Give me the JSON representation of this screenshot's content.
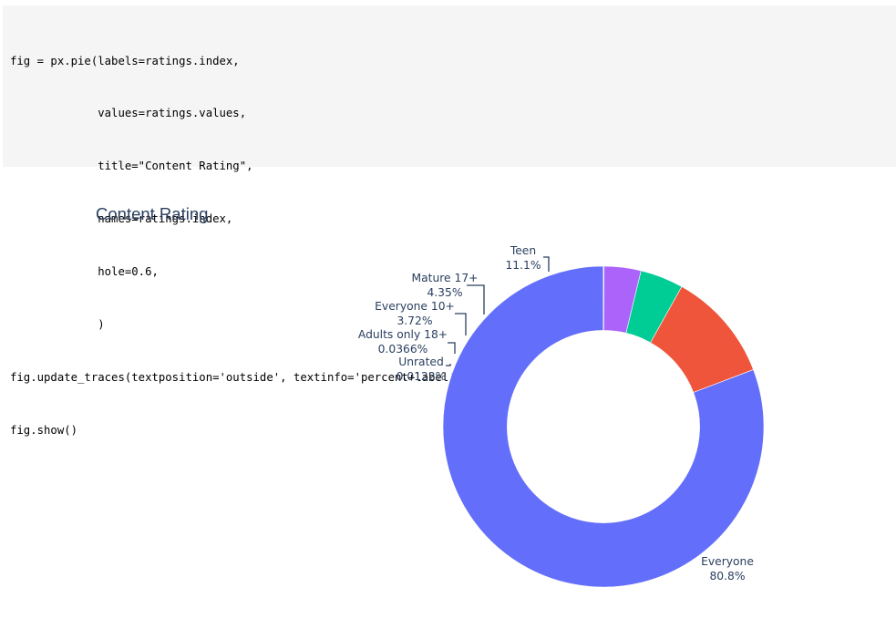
{
  "code_cell": {
    "lines": [
      "fig = px.pie(labels=ratings.index,",
      "             values=ratings.values,",
      "             title=\"Content Rating\",",
      "             names=ratings.index,",
      "             hole=0.6,",
      "             )",
      "fig.update_traces(textposition='outside', textinfo='percent+label')",
      "fig.show()"
    ]
  },
  "chart_data": {
    "type": "pie",
    "title": "Content Rating",
    "hole": 0.6,
    "textposition": "outside",
    "textinfo": "percent+label",
    "slices": [
      {
        "label": "Everyone",
        "percent": 80.8,
        "percent_text": "80.8%",
        "color": "#636efa"
      },
      {
        "label": "Teen",
        "percent": 11.1,
        "percent_text": "11.1%",
        "color": "#ef553b"
      },
      {
        "label": "Mature 17+",
        "percent": 4.35,
        "percent_text": "4.35%",
        "color": "#00cc96"
      },
      {
        "label": "Everyone 10+",
        "percent": 3.72,
        "percent_text": "3.72%",
        "color": "#ab63fa"
      },
      {
        "label": "Adults only 18+",
        "percent": 0.0366,
        "percent_text": "0.0366%",
        "color": "#ffa15a"
      },
      {
        "label": "Unrated",
        "percent": 0.0122,
        "percent_text": "0.0122%",
        "color": "#19d3f3"
      }
    ]
  }
}
